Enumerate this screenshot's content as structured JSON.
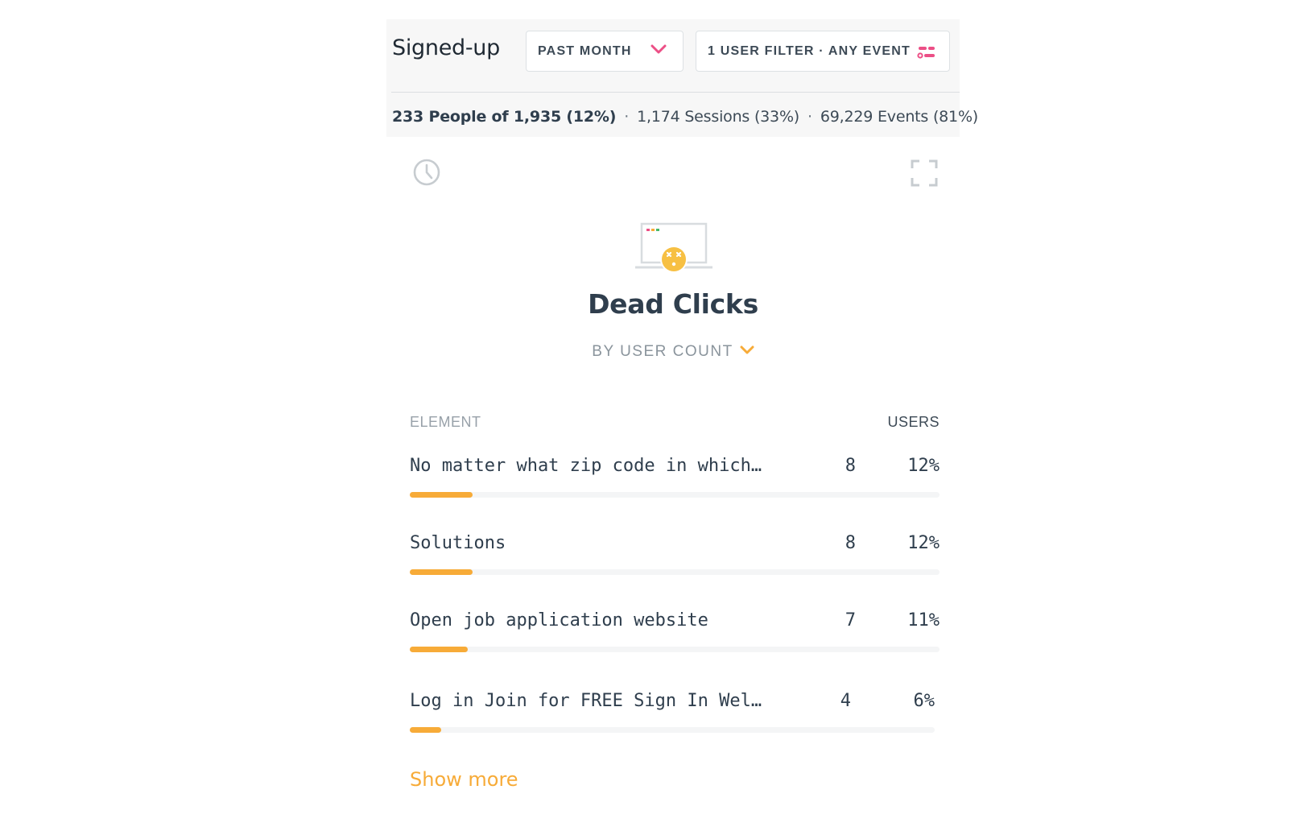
{
  "header": {
    "title": "Signed-up",
    "date_filter": "PAST MONTH",
    "user_filter": "1 USER FILTER · ANY EVENT"
  },
  "stats": {
    "people": "233 People of 1,935 (12%)",
    "sessions": "1,174 Sessions (33%)",
    "events": "69,229 Events (81%)",
    "separator": "·"
  },
  "widget": {
    "title": "Dead Clicks",
    "sort_label": "BY USER COUNT",
    "columns": {
      "element": "ELEMENT",
      "users": "USERS"
    },
    "rows": [
      {
        "element": "No matter what zip code in which…",
        "count": "8",
        "percent": "12%",
        "fraction": 0.12
      },
      {
        "element": "Solutions",
        "count": "8",
        "percent": "12%",
        "fraction": 0.12
      },
      {
        "element": "Open job application website",
        "count": "7",
        "percent": "11%",
        "fraction": 0.11
      },
      {
        "element": "Log in Join for FREE Sign In Wel…",
        "count": "4",
        "percent": "6%",
        "fraction": 0.06
      }
    ],
    "show_more": "Show more"
  },
  "colors": {
    "accent_orange": "#f7ab38",
    "accent_pink": "#ec4f86",
    "text_dark": "#2f3e4d",
    "header_bg": "#f7f7f7"
  },
  "icons": {
    "date_chevron": "chevron-down-icon",
    "filter": "sliders-icon",
    "history": "clock-icon",
    "fullscreen": "expand-icon",
    "illustration": "dead-click-illustration"
  }
}
